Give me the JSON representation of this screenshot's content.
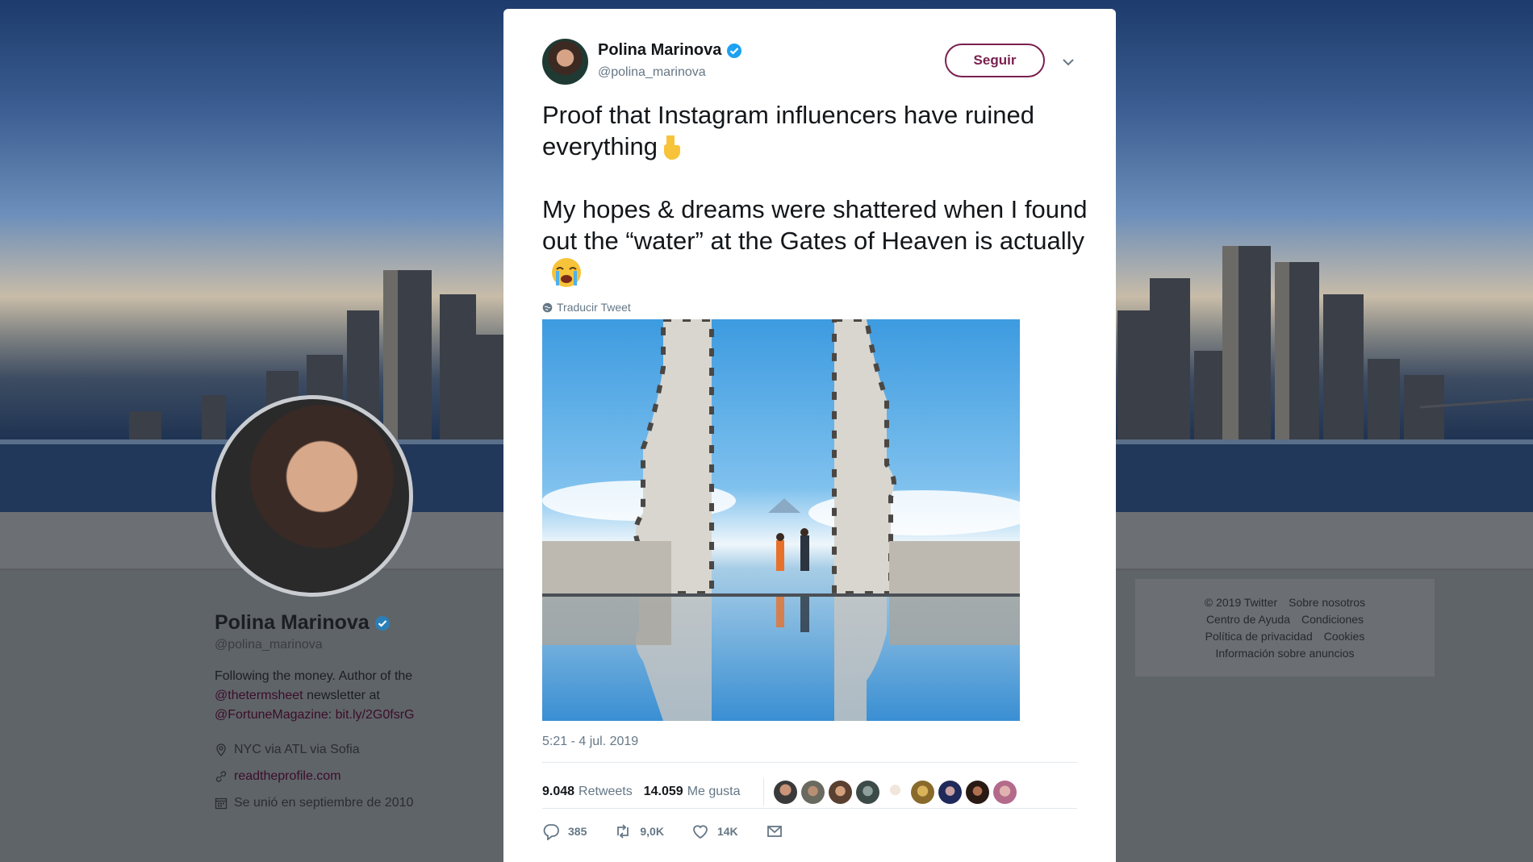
{
  "profile": {
    "name": "Polina Marinova",
    "handle": "@polina_marinova",
    "bio_prefix": "Following the money. Author of the",
    "bio_mention1": "@thetermsheet",
    "bio_mid": " newsletter at",
    "bio_mention2": "@FortuneMagazine",
    "bio_sep": ": ",
    "bio_link": "bit.ly/2G0fsrG",
    "location": "NYC via ATL via Sofia",
    "website": "readtheprofile.com",
    "joined": "Se unió en septiembre de 2010"
  },
  "footer": {
    "copyright": "© 2019 Twitter",
    "about": "Sobre nosotros",
    "help": "Centro de Ayuda",
    "terms": "Condiciones",
    "privacy": "Política de privacidad",
    "cookies": "Cookies",
    "ads": "Información sobre anuncios"
  },
  "tweet": {
    "author_name": "Polina Marinova",
    "author_handle": "@polina_marinova",
    "follow_label": "Seguir",
    "text_line1": "Proof that Instagram influencers have ruined everything",
    "text_line2": "My hopes & dreams were shattered when I found out the “water” at the Gates of Heaven is actually",
    "translate_label": "Traducir Tweet",
    "timestamp": "5:21 - 4 jul. 2019",
    "retweets_count": "9.048",
    "retweets_label": "Retweets",
    "likes_count": "14.059",
    "likes_label": "Me gusta",
    "reply_count": "385",
    "retweet_count_short": "9,0K",
    "like_count_short": "14K",
    "colors": {
      "accent": "#7a2050",
      "verified": "#1da1f2",
      "muted": "#657786"
    },
    "icons": [
      "reply-icon",
      "retweet-icon",
      "like-icon",
      "message-icon",
      "verified-badge-icon",
      "globe-icon",
      "chevron-down-icon"
    ]
  }
}
